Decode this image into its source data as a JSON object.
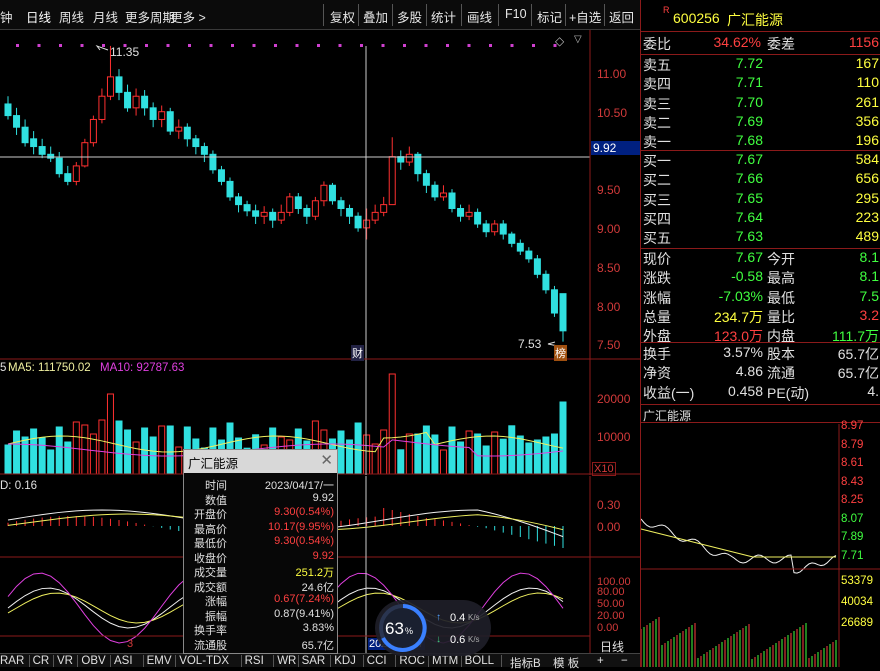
{
  "toolbar": {
    "left_tabs": [
      "分钟",
      "日线",
      "周线",
      "月线",
      "更多周期",
      "更多 >"
    ],
    "right_tabs": [
      "复权",
      "叠加",
      "多股",
      "统计",
      "画线",
      "F10",
      "标记",
      "+自选",
      "返回"
    ]
  },
  "main_chart": {
    "y_ticks": [
      "11.00",
      "10.50",
      "10.00",
      "9.50",
      "9.00",
      "8.50",
      "8.00",
      "7.50"
    ],
    "high_label": "11.35",
    "low_label": "7.53",
    "cursor_value": "9.92",
    "marker_cai": "财",
    "marker_bang": "榜"
  },
  "volume": {
    "legend_left": "5",
    "ma5_label": "MA5: 111750.02",
    "ma10_label": "MA10: 92787.63",
    "y_ticks": [
      "20000",
      "10000"
    ],
    "unit": "X10"
  },
  "macd": {
    "label": "D: 0.16",
    "y_ticks": [
      "0.30",
      "0.00"
    ]
  },
  "kdj": {
    "y_ticks": [
      "100.00",
      "80.00",
      "50.00",
      "20.00",
      "0.00"
    ],
    "label_3": "3",
    "date_label": "2023/04/17"
  },
  "indicator_tabs": [
    "RAR",
    "CR",
    "VR",
    "OBV",
    "ASI",
    "EMV",
    "VOL-TDX",
    "RSI",
    "WR",
    "SAR",
    "KDJ",
    "CCI",
    "ROC",
    "MTM",
    "BOLL"
  ],
  "bottom_right_tabs": [
    "指标B",
    "模 板",
    "+",
    "−"
  ],
  "day_label": "日线",
  "tooltip": {
    "title": "广汇能源",
    "rows": [
      {
        "label": "时间",
        "value": "2023/04/17/一",
        "color": "#e0e0e0"
      },
      {
        "label": "数值",
        "value": "9.92",
        "color": "#e0e0e0"
      },
      {
        "label": "开盘价",
        "value": "9.30(0.54%)",
        "color": "#ff4040"
      },
      {
        "label": "最高价",
        "value": "10.17(9.95%)",
        "color": "#ff4040"
      },
      {
        "label": "最低价",
        "value": "9.30(0.54%)",
        "color": "#ff4040"
      },
      {
        "label": "收盘价",
        "value": "9.92",
        "color": "#ff4040"
      },
      {
        "label": "成交量",
        "value": "251.2万",
        "color": "#ffff40"
      },
      {
        "label": "成交额",
        "value": "24.6亿",
        "color": "#e0e0e0"
      },
      {
        "label": "涨幅",
        "value": "0.67(7.24%)",
        "color": "#ff4040"
      },
      {
        "label": "振幅",
        "value": "0.87(9.41%)",
        "color": "#e0e0e0"
      },
      {
        "label": "换手率",
        "value": "3.83%",
        "color": "#e0e0e0"
      },
      {
        "label": "流通股",
        "value": "65.7亿",
        "color": "#e0e0e0"
      }
    ]
  },
  "network": {
    "percent": "63",
    "up": "0.4",
    "down": "0.6",
    "unit": "K/s"
  },
  "stock": {
    "badge": "R",
    "code": "600256",
    "name": "广汇能源",
    "weibi_label": "委比",
    "weibi": "34.62%",
    "weicha_label": "委差",
    "weicha": "1156",
    "asks": [
      {
        "label": "卖五",
        "price": "7.72",
        "vol": "167"
      },
      {
        "label": "卖四",
        "price": "7.71",
        "vol": "110"
      },
      {
        "label": "卖三",
        "price": "7.70",
        "vol": "261"
      },
      {
        "label": "卖二",
        "price": "7.69",
        "vol": "356"
      },
      {
        "label": "卖一",
        "price": "7.68",
        "vol": "196"
      }
    ],
    "bids": [
      {
        "label": "买一",
        "price": "7.67",
        "vol": "584"
      },
      {
        "label": "买二",
        "price": "7.66",
        "vol": "656"
      },
      {
        "label": "买三",
        "price": "7.65",
        "vol": "295"
      },
      {
        "label": "买四",
        "price": "7.64",
        "vol": "223"
      },
      {
        "label": "买五",
        "price": "7.63",
        "vol": "489"
      }
    ],
    "quote1": [
      {
        "l": "现价",
        "v": "7.67",
        "vc": "#40ff40",
        "l2": "今开",
        "v2": "8.1",
        "v2c": "#40ff40"
      },
      {
        "l": "涨跌",
        "v": "-0.58",
        "vc": "#40ff40",
        "l2": "最高",
        "v2": "8.1",
        "v2c": "#40ff40"
      },
      {
        "l": "涨幅",
        "v": "-7.03%",
        "vc": "#40ff40",
        "l2": "最低",
        "v2": "7.5",
        "v2c": "#40ff40"
      },
      {
        "l": "总量",
        "v": "234.7万",
        "vc": "#ffff40",
        "l2": "量比",
        "v2": "3.2",
        "v2c": "#ff4040"
      },
      {
        "l": "外盘",
        "v": "123.0万",
        "vc": "#ff4040",
        "l2": "内盘",
        "v2": "111.7万",
        "v2c": "#40ff40"
      }
    ],
    "quote2": [
      {
        "l": "换手",
        "v": "3.57%",
        "vc": "#e0e0e0",
        "l2": "股本",
        "v2": "65.7亿",
        "v2c": "#e0e0e0"
      },
      {
        "l": "净资",
        "v": "4.86",
        "vc": "#e0e0e0",
        "l2": "流通",
        "v2": "65.7亿",
        "v2c": "#e0e0e0"
      },
      {
        "l": "收益(一)",
        "v": "0.458",
        "vc": "#e0e0e0",
        "l2": "PE(动)",
        "v2": "4.",
        "v2c": "#e0e0e0"
      }
    ],
    "mini_title": "广汇能源",
    "mini_y_ticks": [
      "8.97",
      "8.79",
      "8.61",
      "8.43",
      "8.25",
      "8.07",
      "7.89",
      "7.71"
    ],
    "mini_vol_ticks": [
      "53379",
      "40034",
      "26689"
    ]
  }
}
